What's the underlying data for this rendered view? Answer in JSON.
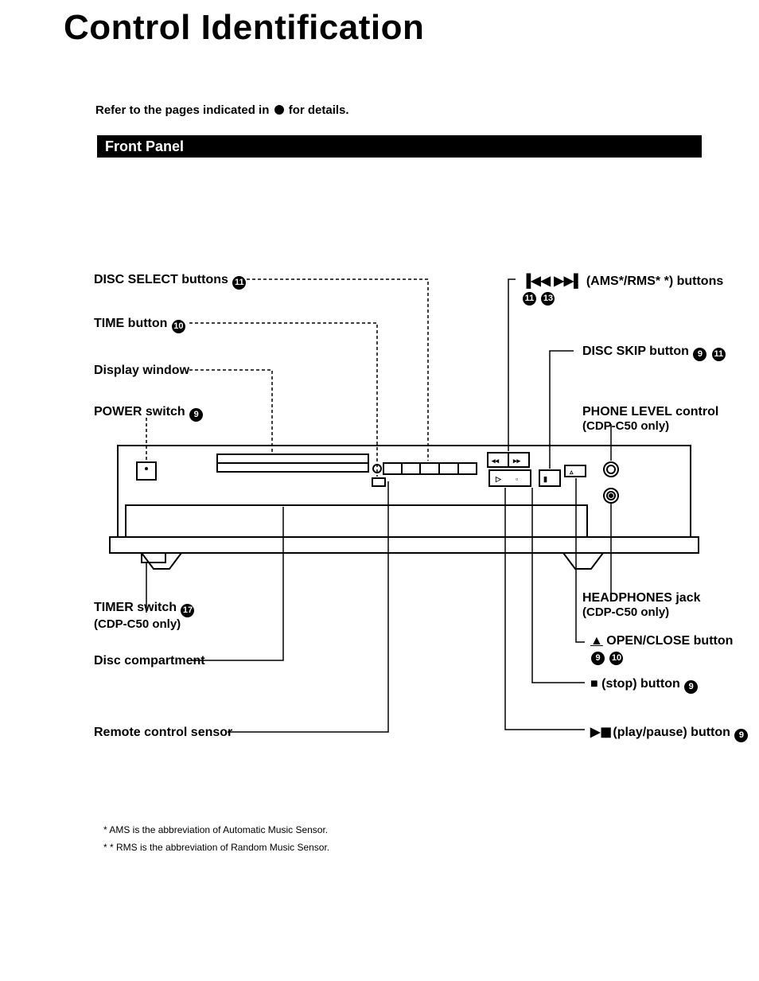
{
  "title": "Control Identification",
  "intro_pre": "Refer to the pages indicated in ",
  "intro_post": " for details.",
  "section": "Front Panel",
  "labels": {
    "disc_select": "DISC SELECT buttons",
    "time": "TIME button",
    "display": "Display window",
    "power": "POWER switch",
    "timer": "TIMER switch",
    "timer_sub": "(CDP-C50 only)",
    "disc_comp": "Disc compartment",
    "remote": "Remote control sensor",
    "ams": "(AMS*/RMS* *) buttons",
    "disc_skip": "DISC SKIP button",
    "phone_level": "PHONE LEVEL control",
    "phone_level_sub": "(CDP-C50 only)",
    "headphones": "HEADPHONES jack",
    "headphones_sub": "(CDP-C50 only)",
    "open_close": "OPEN/CLOSE button",
    "stop": "(stop) button",
    "play": "(play/pause) button"
  },
  "refs": {
    "r9": "9",
    "r10": "10",
    "r11": "11",
    "r13": "13",
    "r17": "17"
  },
  "symbols": {
    "prev": "▐◀◀",
    "next": "▶▶▌",
    "eject": "▲",
    "stop": "■",
    "play": "▶",
    "pause": "▮▮"
  },
  "footnote1": "* AMS is the abbreviation of Automatic Music Sensor.",
  "footnote2": "* * RMS is the abbreviation of Random Music Sensor."
}
